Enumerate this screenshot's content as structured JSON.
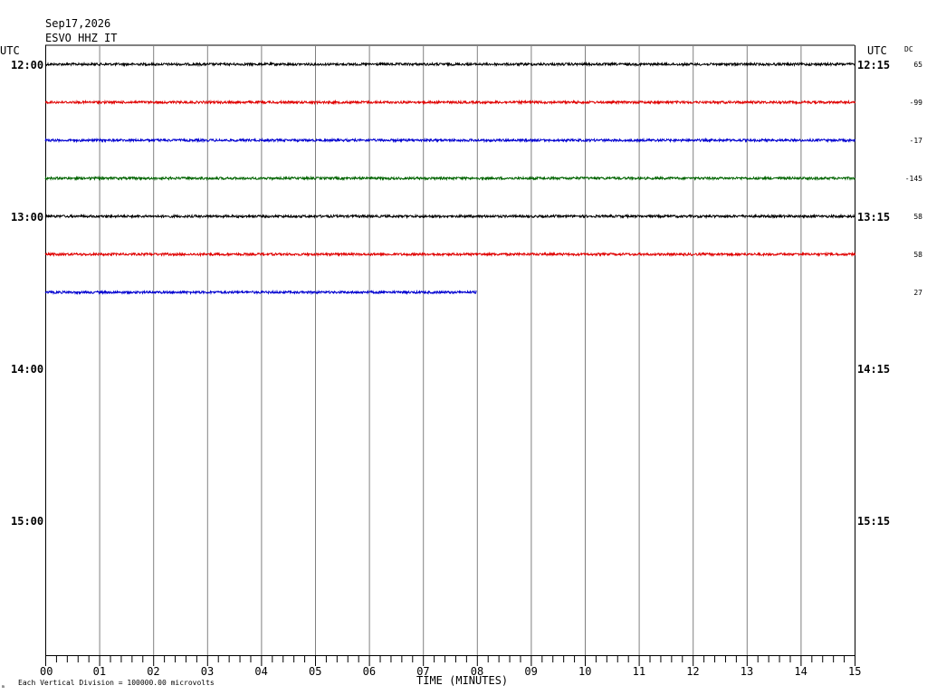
{
  "header": {
    "date": "Sep17,2026",
    "station": "ESVO HHZ IT",
    "utc_left": "UTC",
    "utc_right": "UTC",
    "dc_label": "DC"
  },
  "footer": {
    "xlabel": "TIME (MINUTES)",
    "scale_note": "Each Vertical Division = 100000.00 microvolts",
    "corner_mark": "ₘ"
  },
  "chart_data": {
    "type": "line",
    "title": "",
    "xlabel": "TIME (MINUTES)",
    "xlim": [
      0,
      15
    ],
    "x_ticks": [
      "00",
      "01",
      "02",
      "03",
      "04",
      "05",
      "06",
      "07",
      "08",
      "09",
      "10",
      "11",
      "12",
      "13",
      "14",
      "15"
    ],
    "left_time_labels": [
      {
        "row": 0,
        "label": "12:00"
      },
      {
        "row": 4,
        "label": "13:00"
      },
      {
        "row": 8,
        "label": "14:00"
      },
      {
        "row": 12,
        "label": "15:00"
      }
    ],
    "right_time_labels": [
      {
        "row": 0,
        "label": "12:15"
      },
      {
        "row": 4,
        "label": "13:15"
      },
      {
        "row": 8,
        "label": "14:15"
      },
      {
        "row": 12,
        "label": "15:15"
      }
    ],
    "rows_total": 16,
    "grid": true,
    "series": [
      {
        "row": 0,
        "color": "#000000",
        "end_min": 15,
        "dc": "65"
      },
      {
        "row": 1,
        "color": "#e00000",
        "end_min": 15,
        "dc": "-99"
      },
      {
        "row": 2,
        "color": "#0000d0",
        "end_min": 15,
        "dc": "-17"
      },
      {
        "row": 3,
        "color": "#006400",
        "end_min": 15,
        "dc": "-145"
      },
      {
        "row": 4,
        "color": "#000000",
        "end_min": 15,
        "dc": "58"
      },
      {
        "row": 5,
        "color": "#e00000",
        "end_min": 15,
        "dc": "58"
      },
      {
        "row": 6,
        "color": "#0000d0",
        "end_min": 8,
        "dc": "27"
      }
    ]
  }
}
